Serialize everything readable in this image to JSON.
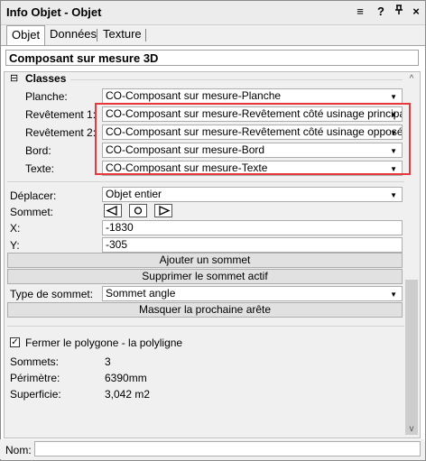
{
  "window": {
    "title": "Info Objet - Objet",
    "icons": [
      "menu-icon",
      "help-icon",
      "pin-icon",
      "close-icon"
    ],
    "icon_glyphs": [
      "≡",
      "?",
      "ᵻ",
      "×"
    ]
  },
  "tabs": [
    {
      "label": "Objet",
      "active": true
    },
    {
      "label": "Données",
      "active": false
    },
    {
      "label": "Texture",
      "active": false
    }
  ],
  "object_type": "Composant sur mesure 3D",
  "classes": {
    "header": "Classes",
    "collapse_glyph": "⊟",
    "rows": [
      {
        "label": "Planche:",
        "value": "CO-Composant sur mesure-Planche"
      },
      {
        "label": "Revêtement 1:",
        "value": "CO-Composant sur mesure-Revêtement côté usinage principal"
      },
      {
        "label": "Revêtement 2:",
        "value": "CO-Composant sur mesure-Revêtement côté usinage opposé"
      },
      {
        "label": "Bord:",
        "value": "CO-Composant sur mesure-Bord"
      },
      {
        "label": "Texte:",
        "value": "CO-Composant sur mesure-Texte"
      }
    ]
  },
  "deplacer": {
    "label": "Déplacer:",
    "value": "Objet entier"
  },
  "sommet": {
    "label": "Sommet:"
  },
  "x": {
    "label": "X:",
    "value": "-1830"
  },
  "y": {
    "label": "Y:",
    "value": "-305"
  },
  "buttons": {
    "add_vertex": "Ajouter un sommet",
    "delete_vertex": "Supprimer le sommet actif",
    "hide_edge": "Masquer la prochaine arête"
  },
  "vertex_type": {
    "label": "Type de sommet:",
    "value": "Sommet angle"
  },
  "close_polygon": {
    "label": "Fermer le polygone - la polyligne",
    "checked": true
  },
  "stats": [
    {
      "label": "Sommets:",
      "value": "3"
    },
    {
      "label": "Périmètre:",
      "value": "6390mm"
    },
    {
      "label": "Superficie:",
      "value": "3,042 m2"
    }
  ],
  "name_field": {
    "label": "Nom:",
    "value": ""
  },
  "colors": {
    "highlight": "#e8383d"
  }
}
